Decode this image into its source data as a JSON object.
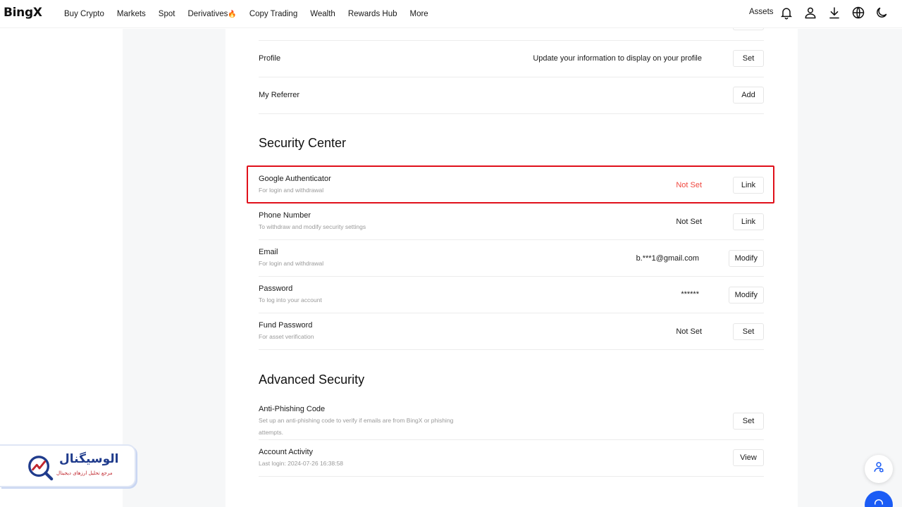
{
  "header": {
    "logo": "BingX",
    "nav": [
      {
        "label": "Buy Crypto"
      },
      {
        "label": "Markets"
      },
      {
        "label": "Spot"
      },
      {
        "label": "Derivatives"
      },
      {
        "label": "Copy Trading"
      },
      {
        "label": "Wealth"
      },
      {
        "label": "Rewards Hub"
      },
      {
        "label": "More"
      }
    ],
    "assets_label": "Assets",
    "icons": [
      "bell-icon",
      "user-icon",
      "download-icon",
      "globe-icon",
      "moon-icon"
    ]
  },
  "profile_rows": [
    {
      "title": "Profile",
      "status": "Update your information to display on your profile",
      "button": "Set"
    },
    {
      "title": "My Referrer",
      "status": "",
      "button": "Add"
    }
  ],
  "security_center": {
    "title": "Security Center",
    "rows": [
      {
        "title": "Google Authenticator",
        "subtitle": "For login and withdrawal",
        "status": "Not Set",
        "status_color": "#f0473e",
        "button": "Link"
      },
      {
        "title": "Phone Number",
        "subtitle": "To withdraw and modify security settings",
        "status": "Not Set",
        "button": "Link"
      },
      {
        "title": "Email",
        "subtitle": "For login and withdrawal",
        "status": "b.***1@gmail.com",
        "button": "Modify"
      },
      {
        "title": "Password",
        "subtitle": "To log into your account",
        "status": "******",
        "button": "Modify"
      },
      {
        "title": "Fund Password",
        "subtitle": "For asset verification",
        "status": "Not Set",
        "button": "Set"
      }
    ]
  },
  "advanced_security": {
    "title": "Advanced Security",
    "rows": [
      {
        "title": "Anti-Phishing Code",
        "subtitle_line1": "Set up an anti-phishing code to verify if emails are from BingX or phishing",
        "subtitle_line2": "attempts.",
        "button": "Set"
      },
      {
        "title": "Account Activity",
        "subtitle": "Last login: 2024-07-26 16:38:58",
        "button": "View"
      }
    ]
  },
  "watermark": {
    "title": "الوسیگنال",
    "subtitle": "مرجع تحلیل ارزهای دیجیتال"
  },
  "colors": {
    "highlight_border": "#e0101a",
    "accent_blue": "#1b5cf5",
    "side_panel": "#f6f7f8"
  }
}
